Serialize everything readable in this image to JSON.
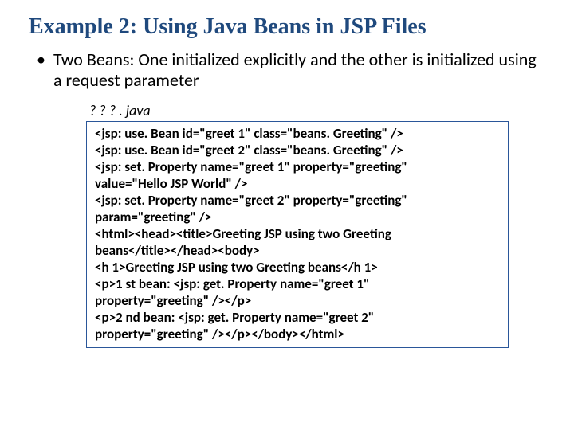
{
  "title": "Example 2: Using Java Beans in JSP Files",
  "bullet": "Two Beans: One initialized explicitly and the other is initialized using a request parameter",
  "filename": "? ? ? . java",
  "code": [
    "<jsp: use. Bean id=\"greet 1\" class=\"beans. Greeting\" />",
    "<jsp: use. Bean id=\"greet 2\" class=\"beans. Greeting\" />",
    "<jsp: set. Property name=\"greet 1\" property=\"greeting\"",
    "value=\"Hello JSP World\" />",
    "<jsp: set. Property name=\"greet 2\" property=\"greeting\"",
    "param=\"greeting\" />",
    "<html><head><title>Greeting JSP using two Greeting",
    "beans</title></head><body>",
    "<h 1>Greeting JSP using two Greeting beans</h 1>",
    "<p>1 st bean: <jsp: get. Property name=\"greet 1\"",
    "property=\"greeting\" /></p>",
    "<p>2 nd bean: <jsp: get. Property name=\"greet 2\"",
    "property=\"greeting\" /></p></body></html>"
  ]
}
